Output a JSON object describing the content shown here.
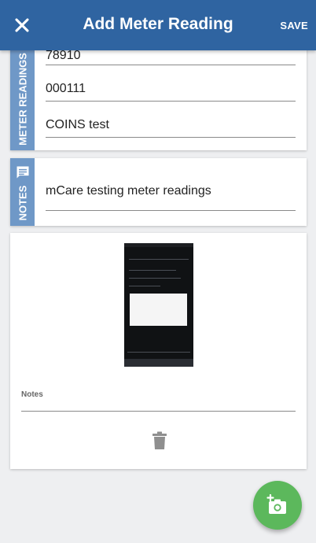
{
  "header": {
    "title": "Add Meter Reading",
    "close_icon": "close-icon",
    "save_label": "SAVE",
    "background": "#2f64a1"
  },
  "meter_readings": {
    "section_label": "METER READINGS",
    "fields": [
      {
        "value": "78910"
      },
      {
        "value": "000111"
      },
      {
        "value": "COINS test"
      }
    ],
    "tab_color": "#6f98c7"
  },
  "notes_section": {
    "section_label": "NOTES",
    "icon": "comment-icon",
    "value": "mCare testing meter readings"
  },
  "photo_card": {
    "image_description_icon": "photo-thumbnail",
    "notes_label": "Notes",
    "notes_value": "",
    "delete_icon": "trash-icon"
  },
  "fab": {
    "icon": "add-photo-icon",
    "color": "#5cb85c"
  }
}
